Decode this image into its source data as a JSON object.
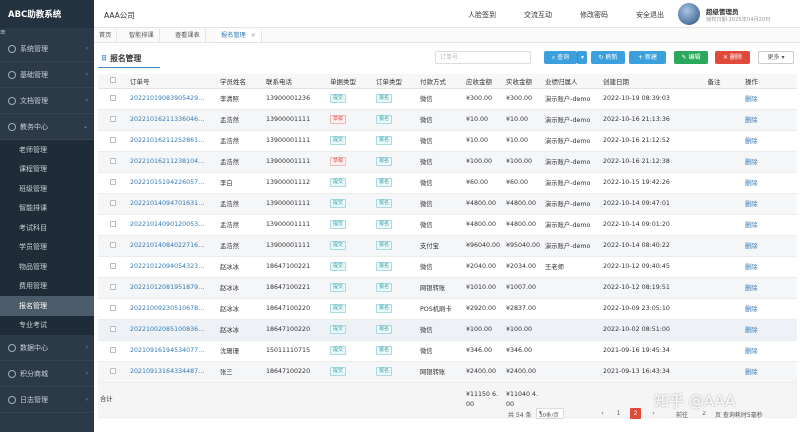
{
  "sidebar": {
    "brand": "ABC助教系统",
    "toggle_icon": "≡",
    "groups_top": [
      {
        "label": "系统管理"
      },
      {
        "label": "基础管理"
      },
      {
        "label": "文档管理"
      },
      {
        "label": "教务中心"
      }
    ],
    "items": [
      {
        "label": "老师管理"
      },
      {
        "label": "课程管理"
      },
      {
        "label": "班级管理"
      },
      {
        "label": "智能排课"
      },
      {
        "label": "考试科目"
      },
      {
        "label": "学员管理"
      },
      {
        "label": "物品管理"
      },
      {
        "label": "费用管理"
      },
      {
        "label": "报名管理"
      },
      {
        "label": "专业考试"
      }
    ],
    "groups_bottom": [
      {
        "label": "数据中心"
      },
      {
        "label": "积分商城"
      },
      {
        "label": "日志管理"
      }
    ]
  },
  "header": {
    "company": "AAA公司",
    "links": [
      "人脸签到",
      "交流互动",
      "修改密码",
      "安全退出"
    ],
    "user_name": "超级管理员",
    "user_expiry": "授权日期:2025年04月20日"
  },
  "tabs": [
    {
      "label": "首页"
    },
    {
      "label": "智能排课"
    },
    {
      "label": "查看课表"
    },
    {
      "label": "报名管理",
      "close": "×"
    }
  ],
  "panel": {
    "title": "报名管理",
    "search_placeholder": "订单号",
    "buttons": {
      "query": "查询",
      "refresh": "刷新",
      "new": "新建",
      "edit": "编辑",
      "delete": "删除",
      "more": "更多"
    }
  },
  "table": {
    "columns": [
      "订单号",
      "学员姓名",
      "联系电话",
      "单据类型",
      "订单类型",
      "付款方式",
      "应收金额",
      "实收金额",
      "业绩归属人",
      "创建日期",
      "备注",
      "操作"
    ],
    "rows": [
      [
        "20221019083905429…",
        "李清照",
        "13900001236",
        "提交",
        "报名",
        "微信",
        "¥300.00",
        "¥300.00",
        "演示账户-demo",
        "2022-10-19 08:39:03",
        "",
        "删除"
      ],
      [
        "20221016211336046…",
        "孟浩然",
        "13900001111",
        "草稿",
        "报名",
        "微信",
        "¥10.00",
        "¥10.00",
        "演示账户-demo",
        "2022-10-16 21:13:36",
        "",
        "删除"
      ],
      [
        "20221016211252861…",
        "孟浩然",
        "13900001111",
        "提交",
        "报名",
        "微信",
        "¥10.00",
        "¥10.00",
        "演示账户-demo",
        "2022-10-16 21:12:52",
        "",
        "删除"
      ],
      [
        "20221016211238104…",
        "孟浩然",
        "13900001111",
        "草稿",
        "报名",
        "微信",
        "¥100.00",
        "¥100.00",
        "演示账户-demo",
        "2022-10-16 21:12:38",
        "",
        "删除"
      ],
      [
        "20221015194226057…",
        "李白",
        "13900001112",
        "提交",
        "报名",
        "微信",
        "¥60.00",
        "¥60.00",
        "演示账户-demo",
        "2022-10-15 19:42:26",
        "",
        "删除"
      ],
      [
        "20221014094701631…",
        "孟浩然",
        "13900001111",
        "提交",
        "报名",
        "微信",
        "¥4800.00",
        "¥4800.00",
        "演示账户-demo",
        "2022-10-14 09:47:01",
        "",
        "删除"
      ],
      [
        "20221014090120053…",
        "孟浩然",
        "13900001111",
        "提交",
        "报名",
        "微信",
        "¥4800.00",
        "¥4800.00",
        "演示账户-demo",
        "2022-10-14 09:01:20",
        "",
        "删除"
      ],
      [
        "20221014084022716…",
        "孟浩然",
        "13900001111",
        "提交",
        "报名",
        "支付宝",
        "¥96040.00",
        "¥95040.00",
        "演示账户-demo",
        "2022-10-14 08:40:22",
        "",
        "删除"
      ],
      [
        "20221012094054323…",
        "赵冰冰",
        "18647100221",
        "提交",
        "报名",
        "微信",
        "¥2040.00",
        "¥2034.00",
        "王老师",
        "2022-10-12 09:40:45",
        "",
        "删除"
      ],
      [
        "20221012081951879…",
        "赵冰冰",
        "18647100221",
        "提交",
        "报名",
        "网银转账",
        "¥1010.00",
        "¥1007.00",
        "",
        "2022-10-12 08:19:51",
        "",
        "删除"
      ],
      [
        "20221009230510678…",
        "赵冰冰",
        "18647100220",
        "提交",
        "报名",
        "POS机刷卡",
        "¥2920.00",
        "¥2837.00",
        "",
        "2022-10-09 23:05:10",
        "",
        "删除"
      ],
      [
        "20221002085100836…",
        "赵冰冰",
        "18647100220",
        "提交",
        "报名",
        "微信",
        "¥100.00",
        "¥100.00",
        "",
        "2022-10-02 08:51:00",
        "",
        "删除"
      ],
      [
        "20210916194534077…",
        "沈珊珊",
        "15011110715",
        "提交",
        "报名",
        "微信",
        "¥346.00",
        "¥346.00",
        "",
        "2021-09-16 19:45:34",
        "",
        "删除"
      ],
      [
        "20210913164334487…",
        "张三",
        "18647100220",
        "提交",
        "报名",
        "网银转账",
        "¥2400.00",
        "¥2400.00",
        "",
        "2021-09-13 16:43:34",
        "",
        "删除"
      ]
    ],
    "total_label": "合计",
    "total_receivable": "¥11150 6.00",
    "total_received": "¥11040 4.00"
  },
  "pager": {
    "total": "共 54 条",
    "page_size": "30条/页",
    "prev": "‹",
    "pages": [
      "1",
      "2"
    ],
    "active_page": "2",
    "next": "›",
    "goto_label": "前往",
    "goto_value": "2",
    "goto_suffix": "页 查询耗时5毫秒"
  },
  "watermark": "知乎 @AAA",
  "colors": {
    "sidebar": "#2c3a47",
    "accent": "#3ca0dc",
    "green": "#2aa85b",
    "red": "#e04a3a",
    "link": "#337ab7"
  }
}
